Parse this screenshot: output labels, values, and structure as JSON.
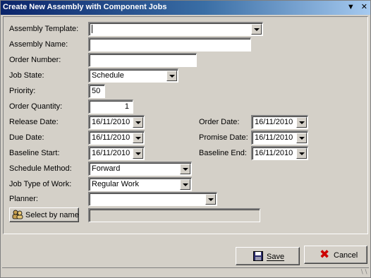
{
  "window": {
    "title": "Create New Assembly with Component Jobs"
  },
  "form": {
    "assembly_template": {
      "label": "Assembly Template:",
      "value": ""
    },
    "assembly_name": {
      "label": "Assembly Name:",
      "value": ""
    },
    "order_number": {
      "label": "Order Number:",
      "value": ""
    },
    "job_state": {
      "label": "Job State:",
      "value": "Schedule"
    },
    "priority": {
      "label": "Priority:",
      "value": "50"
    },
    "order_quantity": {
      "label": "Order Quantity:",
      "value": "1"
    },
    "release_date": {
      "label": "Release Date:",
      "value": "16/11/2010"
    },
    "due_date": {
      "label": "Due Date:",
      "value": "16/11/2010"
    },
    "baseline_start": {
      "label": "Baseline Start:",
      "value": "16/11/2010"
    },
    "order_date": {
      "label": "Order Date:",
      "value": "16/11/2010"
    },
    "promise_date": {
      "label": "Promise Date:",
      "value": "16/11/2010"
    },
    "baseline_end": {
      "label": "Baseline End:",
      "value": "16/11/2010"
    },
    "schedule_method": {
      "label": "Schedule Method:",
      "value": "Forward"
    },
    "job_type_of_work": {
      "label": "Job Type of Work:",
      "value": "Regular Work"
    },
    "planner": {
      "label": "Planner:",
      "value": ""
    },
    "select_by_name": {
      "label": "Select by name",
      "value": ""
    }
  },
  "buttons": {
    "save": "Save",
    "cancel": "Cancel"
  },
  "colors": {
    "title_start": "#0a246a",
    "title_end": "#a6caf0",
    "face": "#d4d0c8",
    "cancel_icon": "#cc0000"
  }
}
